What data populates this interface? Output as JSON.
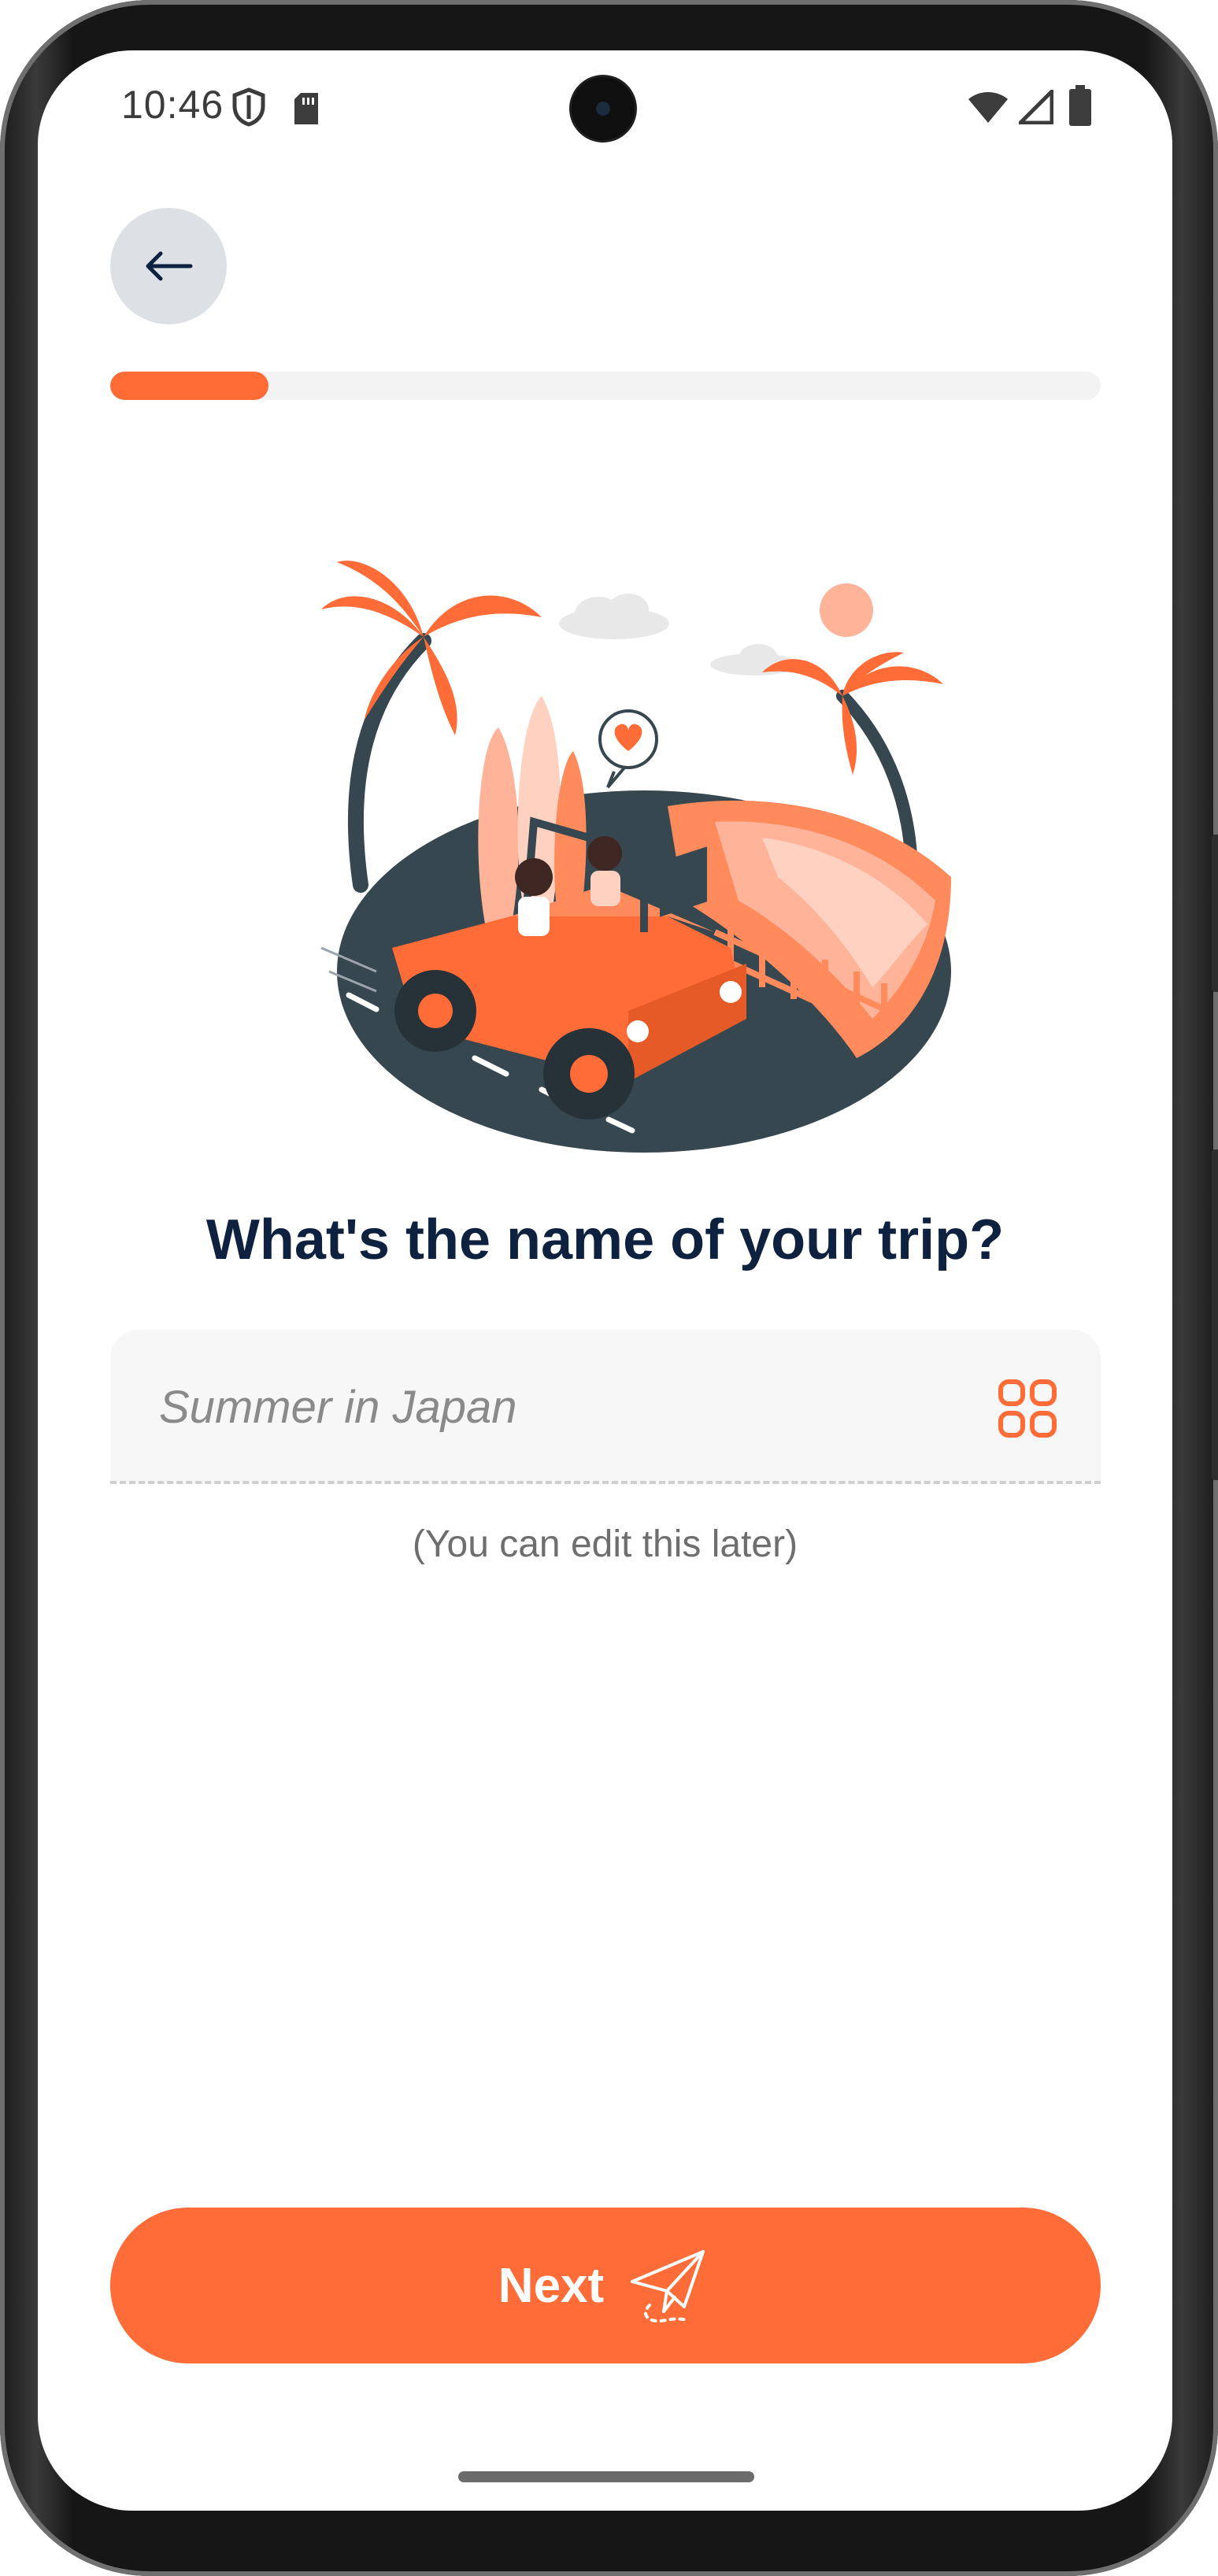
{
  "status_bar": {
    "time": "10:46",
    "left_icons": [
      "shield-icon",
      "sd-card-icon"
    ],
    "right_icons": [
      "wifi-icon",
      "signal-icon",
      "battery-icon"
    ]
  },
  "navigation": {
    "back_icon": "arrow-left-icon"
  },
  "progress": {
    "fraction": 0.16,
    "fill_color": "#ff6b35",
    "track_color": "#f3f3f3"
  },
  "main": {
    "illustration": "road-trip-jeep-illustration",
    "title": "What's the name of your trip?",
    "trip_name_input": {
      "value": "",
      "placeholder": "Summer in Japan",
      "trailing_icon": "grid-icon"
    },
    "hint": "(You can edit this later)"
  },
  "footer": {
    "next_label": "Next",
    "next_icon": "paper-plane-icon"
  },
  "colors": {
    "accent": "#ff6c37",
    "title": "#0e2240",
    "back_button_bg": "#dde1e5"
  }
}
